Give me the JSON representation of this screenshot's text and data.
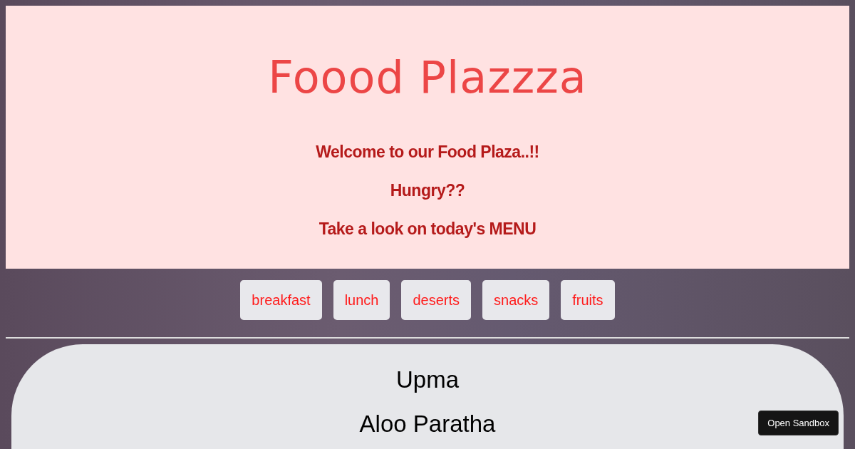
{
  "header": {
    "title": "Foood Plazzza",
    "lines": [
      "Welcome to our Food Plaza..!!",
      "Hungry??",
      "Take a look on today's MENU"
    ]
  },
  "categories": [
    "breakfast",
    "lunch",
    "deserts",
    "snacks",
    "fruits"
  ],
  "menu_items": [
    "Upma",
    "Aloo Paratha"
  ],
  "sandbox_button": "Open Sandbox"
}
